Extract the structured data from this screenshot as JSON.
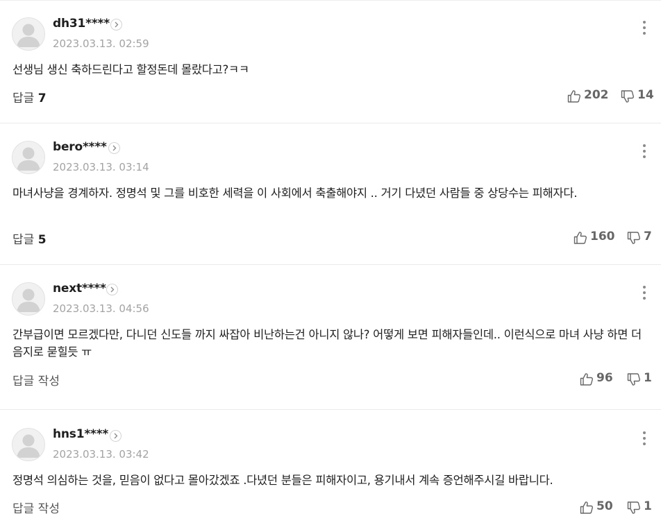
{
  "comments": [
    {
      "username": "dh31****",
      "date": "2023.03.13. 02:59",
      "text": "선생님 생신 축하드린다고 할정돈데 몰랐다고?ㅋㅋ",
      "reply_label": "답글",
      "reply_count": "7",
      "likes": "202",
      "dislikes": "14"
    },
    {
      "username": "bero****",
      "date": "2023.03.13. 03:14",
      "text": "마녀사냥을 경계하자. 정명석 및 그를 비호한 세력을 이 사회에서 축출해야지 .. 거기 다녔던 사람들 중 상당수는 피해자다.",
      "reply_label": "답글",
      "reply_count": "5",
      "likes": "160",
      "dislikes": "7"
    },
    {
      "username": "next****",
      "date": "2023.03.13. 04:56",
      "text": "간부급이면 모르겠다만, 다니던 신도들 까지 싸잡아 비난하는건 아니지 않나? 어떻게 보면 피해자들인데.. 이런식으로 마녀 사냥 하면 더 음지로 묻힐듯 ㅠ",
      "reply_label": "답글 작성",
      "reply_count": "",
      "likes": "96",
      "dislikes": "1"
    },
    {
      "username": "hns1****",
      "date": "2023.03.13. 03:42",
      "text": "정명석 의심하는 것을, 믿음이 없다고 몰아갔겠죠 .다녔던 분들은 피해자이고, 용기내서 계속 증언해주시길 바랍니다.",
      "reply_label": "답글 작성",
      "reply_count": "",
      "likes": "50",
      "dislikes": "1"
    }
  ]
}
